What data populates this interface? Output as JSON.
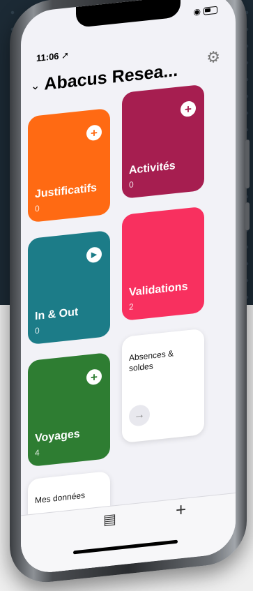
{
  "status": {
    "time": "11:06"
  },
  "header": {
    "title": "Abacus Resea..."
  },
  "tiles": [
    {
      "label": "Justificatifs",
      "count": "0",
      "action": "+"
    },
    {
      "label": "Activités",
      "count": "0",
      "action": "+"
    },
    {
      "label": "In & Out",
      "count": "0",
      "action": "▶"
    },
    {
      "label": "Validations",
      "count": "2"
    },
    {
      "label": "Voyages",
      "count": "4",
      "action": "+"
    },
    {
      "label": "Absences & soldes",
      "action": "→"
    },
    {
      "label": "Mes données"
    }
  ],
  "tabbar": {
    "plus": "+"
  },
  "colors": {
    "justificatifs": "#ff6a13",
    "activites": "#a61e50",
    "in_out": "#1c7c88",
    "validations": "#f8305f",
    "voyages": "#2e7d32"
  }
}
